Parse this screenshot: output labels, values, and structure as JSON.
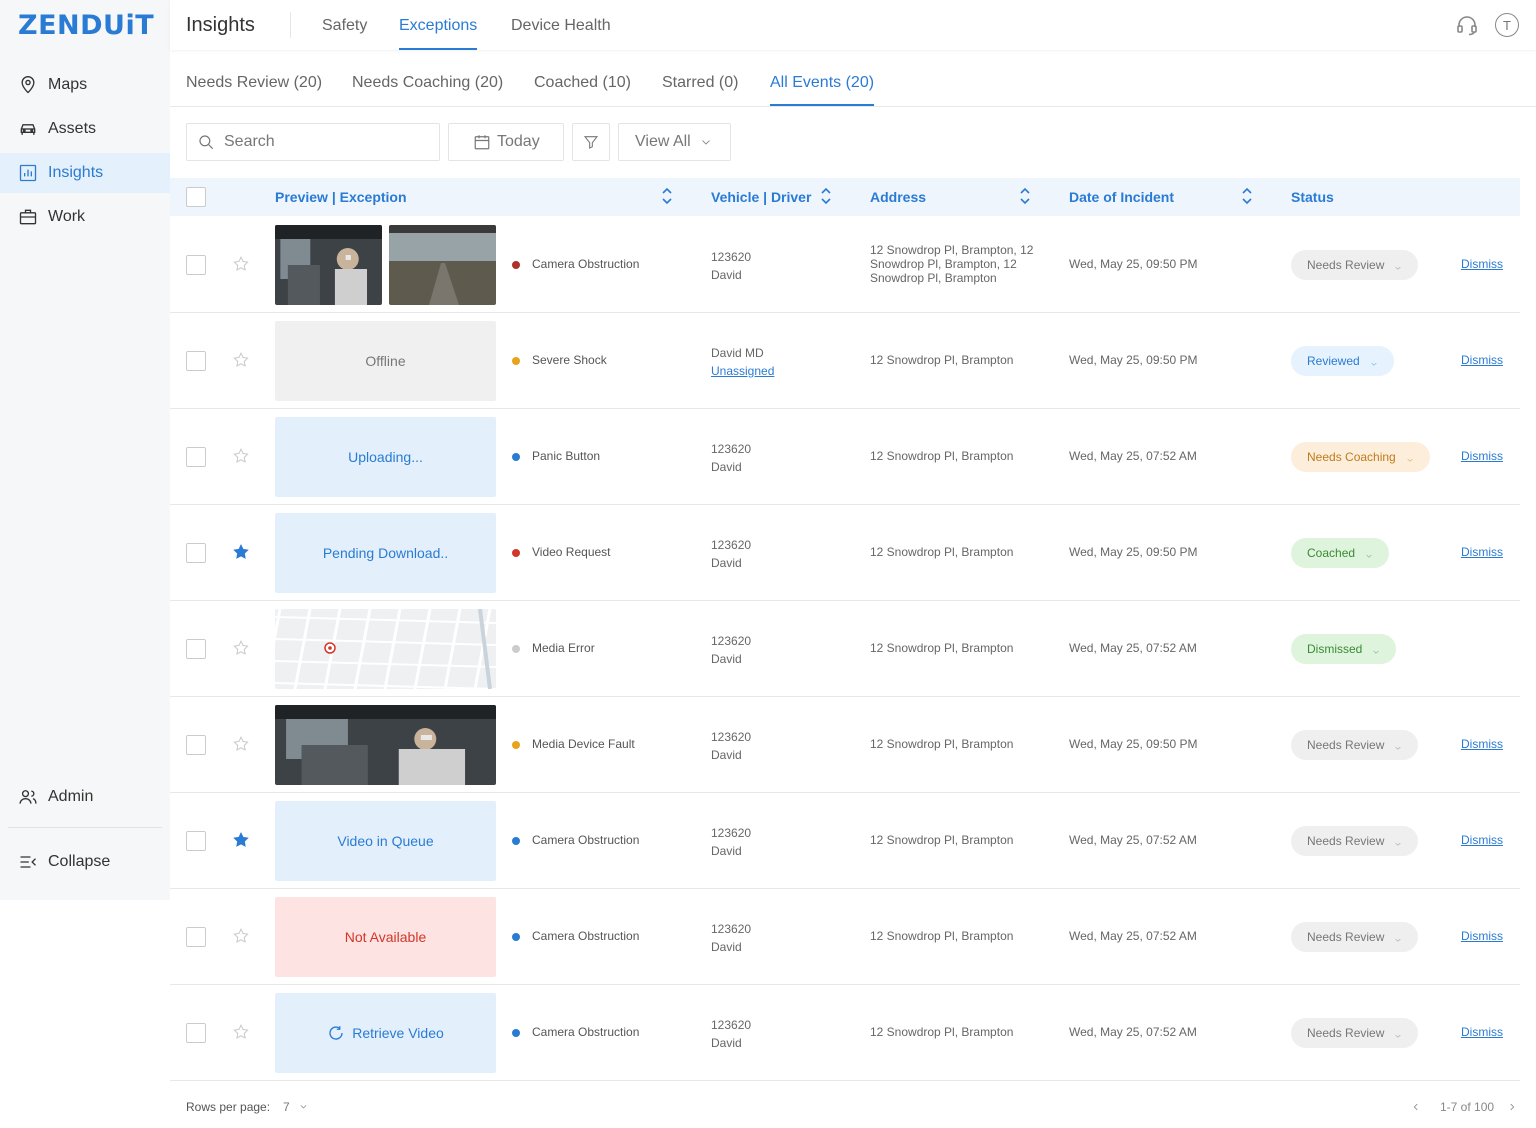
{
  "brand": {
    "logo_text": "ZENDUiT",
    "accent": "#2a7bd4"
  },
  "sidebar": {
    "items": [
      {
        "label": "Maps",
        "icon": "map-pin-icon"
      },
      {
        "label": "Assets",
        "icon": "car-icon"
      },
      {
        "label": "Insights",
        "icon": "chart-icon",
        "active": true
      },
      {
        "label": "Work",
        "icon": "briefcase-icon"
      }
    ],
    "admin_label": "Admin",
    "collapse_label": "Collapse"
  },
  "header": {
    "title": "Insights",
    "tabs": [
      "Safety",
      "Exceptions",
      "Device Health"
    ],
    "active_tab": "Exceptions",
    "avatar_initial": "T"
  },
  "subtabs": [
    "Needs Review (20)",
    "Needs Coaching (20)",
    "Coached (10)",
    "Starred (0)",
    "All Events (20)"
  ],
  "toolbar": {
    "search_placeholder": "Search",
    "date_label": "Today",
    "view_label": "View All"
  },
  "table": {
    "columns": [
      "Preview | Exception",
      "Vehicle | Driver",
      "Address",
      "Date of Incident",
      "Status"
    ],
    "rows": [
      {
        "preview": "",
        "preview_type": "images",
        "exception": "Camera Obstruction",
        "dot": "#b0302a",
        "vehicle": "123620",
        "driver": "David",
        "address": "12 Snowdrop Pl, Brampton, 12 Snowdrop Pl, Brampton, 12 Snowdrop Pl, Brampton",
        "date": "Wed, May 25, 09:50 PM",
        "status": "Needs Review",
        "status_style": "grey",
        "dismiss": "Dismiss",
        "starred": false
      },
      {
        "preview": "Offline",
        "preview_type": "grey",
        "exception": "Severe Shock",
        "dot": "#e8a21c",
        "vehicle": "David MD",
        "driver": "Unassigned",
        "driver_link": true,
        "address": "12 Snowdrop Pl, Brampton",
        "date": "Wed, May 25, 09:50 PM",
        "status": "Reviewed",
        "status_style": "blue",
        "dismiss": "Dismiss",
        "starred": false
      },
      {
        "preview": "Uploading...",
        "preview_type": "blue",
        "exception": "Panic Button",
        "dot": "#2a7bd4",
        "vehicle": "123620",
        "driver": "David",
        "address": "12 Snowdrop Pl, Brampton",
        "date": "Wed, May 25, 07:52 AM",
        "status": "Needs Coaching",
        "status_style": "orange",
        "dismiss": "Dismiss",
        "starred": false
      },
      {
        "preview": "Pending Download..",
        "preview_type": "blue",
        "exception": "Video Request",
        "dot": "#d2372b",
        "vehicle": "123620",
        "driver": "David",
        "address": "12 Snowdrop Pl, Brampton",
        "date": "Wed, May 25, 09:50 PM",
        "status": "Coached",
        "status_style": "green",
        "dismiss": "Dismiss",
        "starred": true
      },
      {
        "preview": "",
        "preview_type": "map",
        "exception": "Media Error",
        "dot": "#cccccc",
        "vehicle": "123620",
        "driver": "David",
        "address": "12 Snowdrop Pl, Brampton",
        "date": "Wed, May 25, 07:52 AM",
        "status": "Dismissed",
        "status_style": "green",
        "dismiss": "",
        "starred": false
      },
      {
        "preview": "",
        "preview_type": "cabin",
        "exception": "Media Device Fault",
        "dot": "#e8a21c",
        "vehicle": "123620",
        "driver": "David",
        "address": "12 Snowdrop Pl, Brampton",
        "date": "Wed, May 25, 09:50 PM",
        "status": "Needs Review",
        "status_style": "grey",
        "dismiss": "Dismiss",
        "starred": false
      },
      {
        "preview": "Video in Queue",
        "preview_type": "blue",
        "exception": "Camera Obstruction",
        "dot": "#2a7bd4",
        "vehicle": "123620",
        "driver": "David",
        "address": "12 Snowdrop Pl, Brampton",
        "date": "Wed, May 25, 07:52 AM",
        "status": "Needs Review",
        "status_style": "grey",
        "dismiss": "Dismiss",
        "starred": true
      },
      {
        "preview": "Not Available",
        "preview_type": "red",
        "exception": "Camera Obstruction",
        "dot": "#2a7bd4",
        "vehicle": "123620",
        "driver": "David",
        "address": "12 Snowdrop Pl, Brampton",
        "date": "Wed, May 25, 07:52 AM",
        "status": "Needs Review",
        "status_style": "grey",
        "dismiss": "Dismiss",
        "starred": false
      },
      {
        "preview": "Retrieve Video",
        "preview_type": "blue-retrieve",
        "exception": "Camera Obstruction",
        "dot": "#2a7bd4",
        "vehicle": "123620",
        "driver": "David",
        "address": "12 Snowdrop Pl, Brampton",
        "date": "Wed, May 25, 07:52 AM",
        "status": "Needs Review",
        "status_style": "grey",
        "dismiss": "Dismiss",
        "starred": false
      }
    ]
  },
  "footer": {
    "rows_label": "Rows per page:",
    "rows_value": "7",
    "range": "1-7 of 100"
  }
}
